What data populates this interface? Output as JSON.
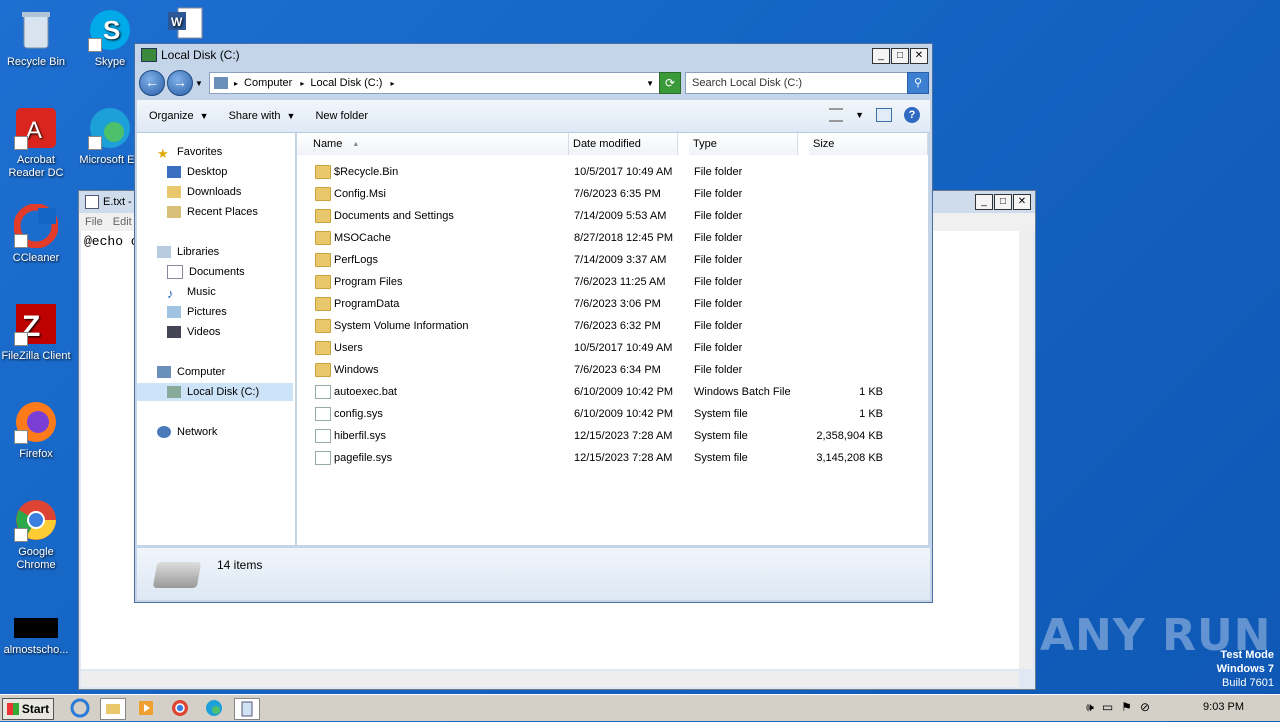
{
  "desktop": {
    "icons": [
      {
        "label": "Recycle Bin"
      },
      {
        "label": "Skype"
      },
      {
        "label": "Acrobat Reader DC"
      },
      {
        "label": "Microsoft Ed"
      },
      {
        "label": "CCleaner"
      },
      {
        "label": "FileZilla Client"
      },
      {
        "label": "Firefox"
      },
      {
        "label": "Google Chrome"
      },
      {
        "label": "almostscho..."
      }
    ],
    "watermark": "ANY RUN",
    "test_mode": {
      "line1": "Test Mode",
      "line2": "Windows 7",
      "line3": "Build 7601"
    }
  },
  "notepad": {
    "title": "E.txt -",
    "menu": {
      "file": "File",
      "edit": "Edit"
    },
    "content": "@echo o"
  },
  "explorer": {
    "title": "Local Disk (C:)",
    "address": {
      "crumb1": "Computer",
      "crumb2": "Local Disk (C:)"
    },
    "search_placeholder": "Search Local Disk (C:)",
    "toolbar": {
      "organize": "Organize",
      "share_with": "Share with",
      "new_folder": "New folder"
    },
    "nav": {
      "favorites": "Favorites",
      "desktop": "Desktop",
      "downloads": "Downloads",
      "recent_places": "Recent Places",
      "libraries": "Libraries",
      "documents": "Documents",
      "music": "Music",
      "pictures": "Pictures",
      "videos": "Videos",
      "computer": "Computer",
      "local_disk": "Local Disk (C:)",
      "network": "Network"
    },
    "columns": {
      "name": "Name",
      "date": "Date modified",
      "type": "Type",
      "size": "Size"
    },
    "rows": [
      {
        "name": "$Recycle.Bin",
        "date": "10/5/2017 10:49 AM",
        "type": "File folder",
        "size": "",
        "kind": "folder"
      },
      {
        "name": "Config.Msi",
        "date": "7/6/2023 6:35 PM",
        "type": "File folder",
        "size": "",
        "kind": "folder"
      },
      {
        "name": "Documents and Settings",
        "date": "7/14/2009 5:53 AM",
        "type": "File folder",
        "size": "",
        "kind": "link"
      },
      {
        "name": "MSOCache",
        "date": "8/27/2018 12:45 PM",
        "type": "File folder",
        "size": "",
        "kind": "folder"
      },
      {
        "name": "PerfLogs",
        "date": "7/14/2009 3:37 AM",
        "type": "File folder",
        "size": "",
        "kind": "folder"
      },
      {
        "name": "Program Files",
        "date": "7/6/2023 11:25 AM",
        "type": "File folder",
        "size": "",
        "kind": "folder"
      },
      {
        "name": "ProgramData",
        "date": "7/6/2023 3:06 PM",
        "type": "File folder",
        "size": "",
        "kind": "folder"
      },
      {
        "name": "System Volume Information",
        "date": "7/6/2023 6:32 PM",
        "type": "File folder",
        "size": "",
        "kind": "folder"
      },
      {
        "name": "Users",
        "date": "10/5/2017 10:49 AM",
        "type": "File folder",
        "size": "",
        "kind": "folder"
      },
      {
        "name": "Windows",
        "date": "7/6/2023 6:34 PM",
        "type": "File folder",
        "size": "",
        "kind": "folder"
      },
      {
        "name": "autoexec.bat",
        "date": "6/10/2009 10:42 PM",
        "type": "Windows Batch File",
        "size": "1 KB",
        "kind": "file"
      },
      {
        "name": "config.sys",
        "date": "6/10/2009 10:42 PM",
        "type": "System file",
        "size": "1 KB",
        "kind": "file"
      },
      {
        "name": "hiberfil.sys",
        "date": "12/15/2023 7:28 AM",
        "type": "System file",
        "size": "2,358,904 KB",
        "kind": "file"
      },
      {
        "name": "pagefile.sys",
        "date": "12/15/2023 7:28 AM",
        "type": "System file",
        "size": "3,145,208 KB",
        "kind": "file"
      }
    ],
    "status": "14 items"
  },
  "taskbar": {
    "start": "Start",
    "clock": "9:03 PM"
  }
}
